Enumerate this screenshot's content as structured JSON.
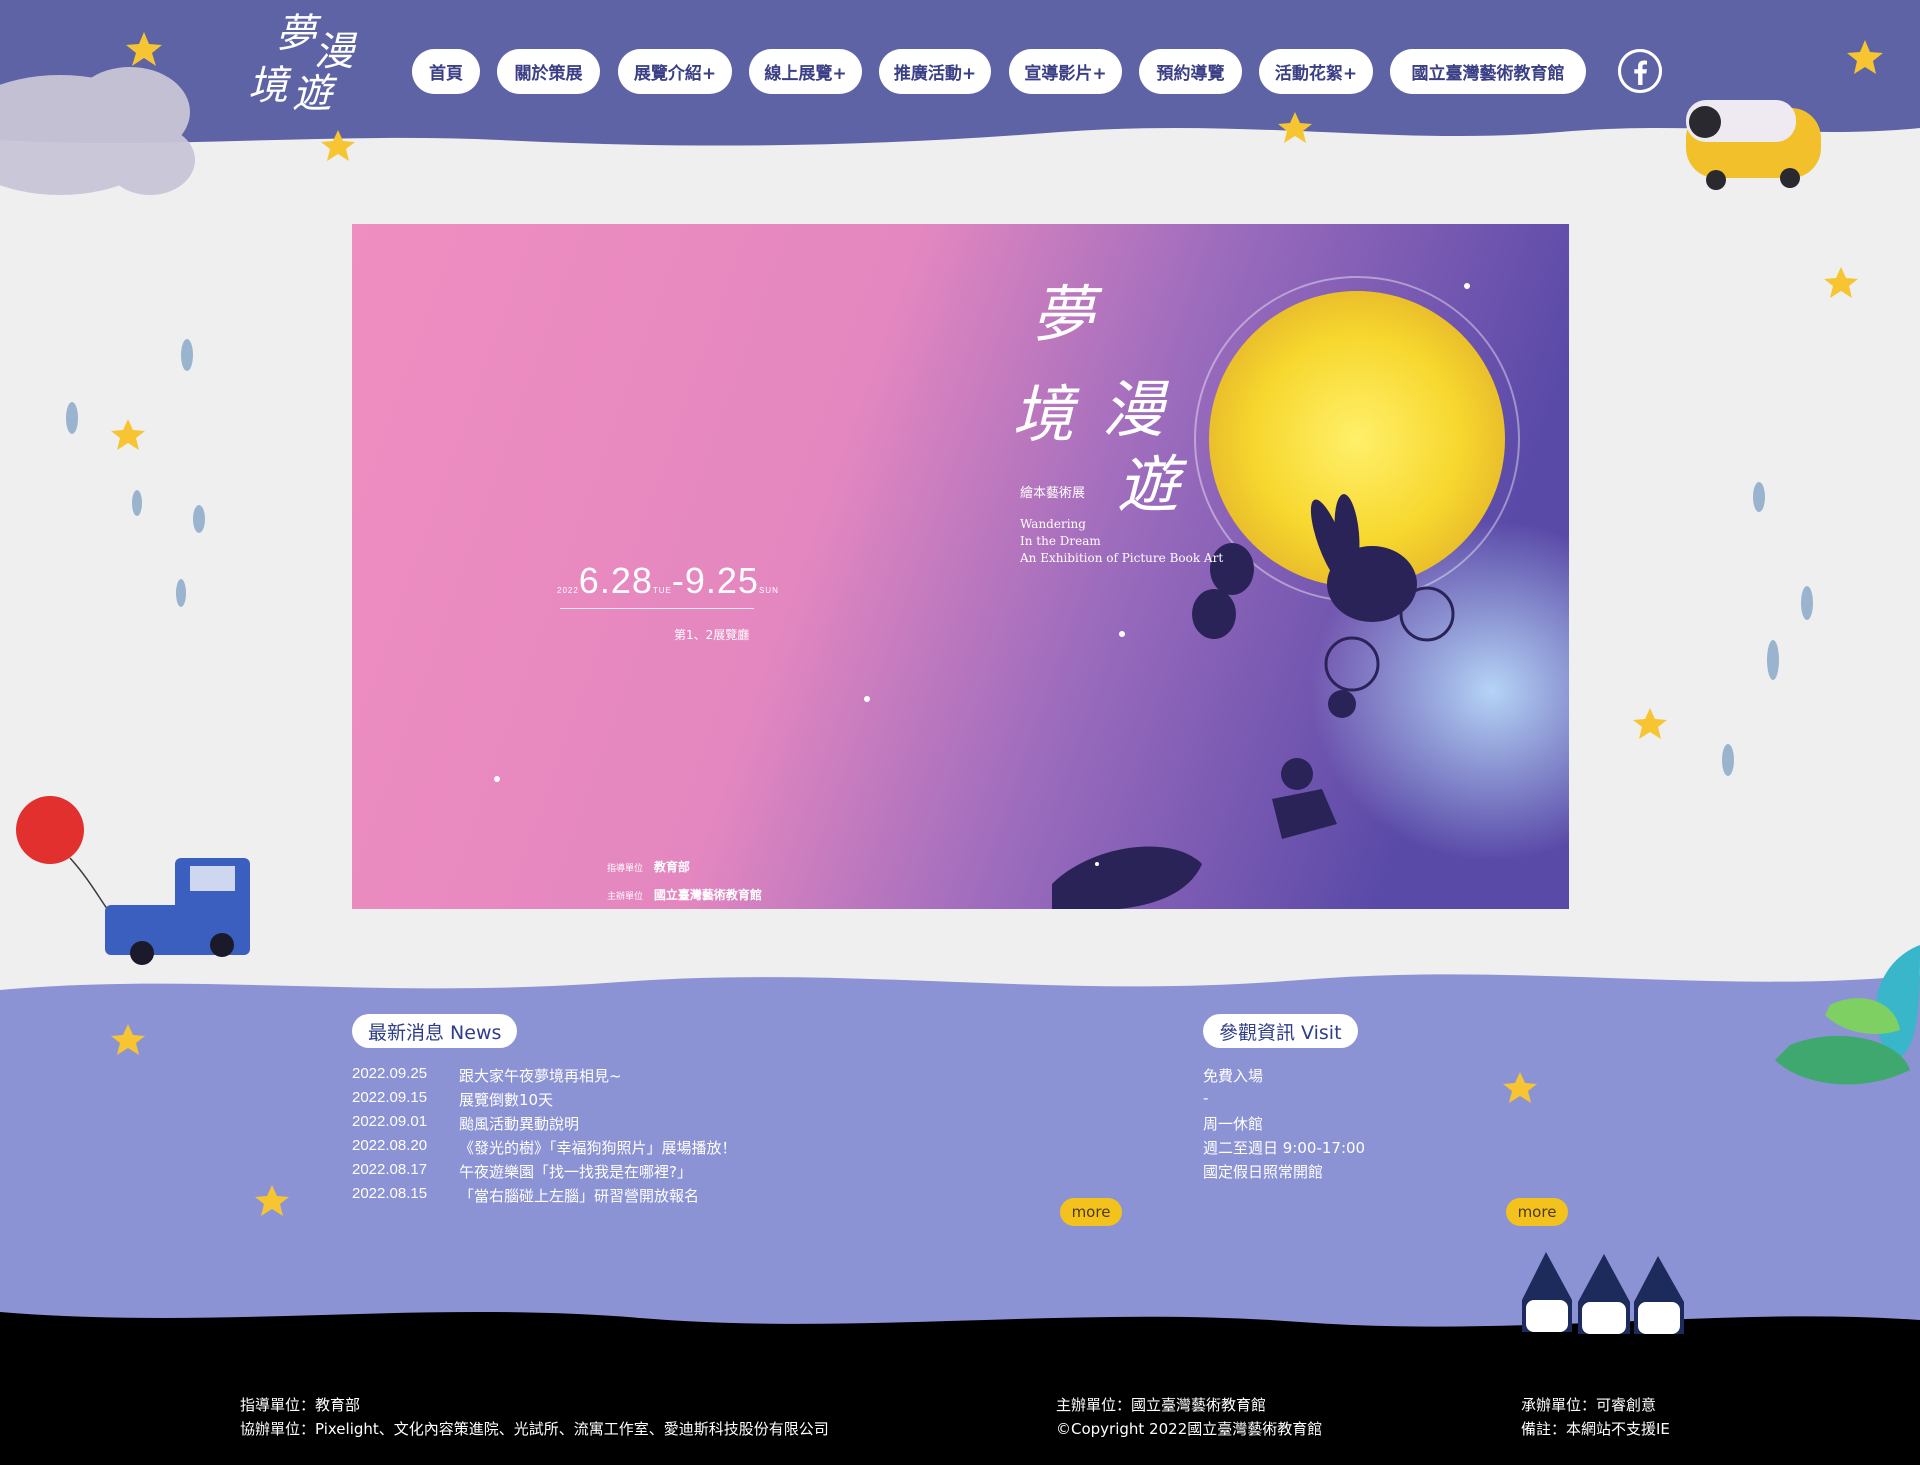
{
  "header": {
    "logo_chars": [
      "夢",
      "漫",
      "境",
      "遊"
    ],
    "nav": [
      "首頁",
      "關於策展",
      "展覽介紹+",
      "線上展覽+",
      "推廣活動+",
      "宣導影片+",
      "預約導覽",
      "活動花絮+",
      "國立臺灣藝術教育館"
    ],
    "social_icon": "facebook-icon"
  },
  "hero": {
    "title_chars": [
      "夢",
      "境",
      "漫",
      "遊"
    ],
    "subtitle": "繪本藝術展",
    "english_lines": [
      "Wandering",
      "In the Dream",
      "An Exhibition of Picture Book Art"
    ],
    "year": "2022",
    "date_start": "6.28",
    "day_start": "TUE",
    "date_end": "9.25",
    "day_end": "SUN",
    "venue": "第1、2展覽廳",
    "guide_label": "指導單位",
    "guide_org": "教育部",
    "host_label": "主辦單位",
    "host_org": "國立臺灣藝術教育館"
  },
  "news": {
    "title": "最新消息 News",
    "items": [
      {
        "date": "2022.09.25",
        "text": "跟大家午夜夢境再相見~"
      },
      {
        "date": "2022.09.15",
        "text": "展覽倒數10天"
      },
      {
        "date": "2022.09.01",
        "text": "颱風活動異動說明"
      },
      {
        "date": "2022.08.20",
        "text": "《發光的樹》「幸福狗狗照片」展場播放！"
      },
      {
        "date": "2022.08.17",
        "text": "午夜遊樂園「找一找我是在哪裡?」"
      },
      {
        "date": "2022.08.15",
        "text": "「當右腦碰上左腦」研習營開放報名"
      }
    ],
    "more": "more"
  },
  "visit": {
    "title": "參觀資訊 Visit",
    "lines": [
      "免費入場",
      "-",
      "周一休館",
      "週二至週日 9:00-17:00",
      "國定假日照常開館"
    ],
    "more": "more"
  },
  "footer": {
    "guide": "指導單位：教育部",
    "co_organizers": "協辦單位：Pixelight、文化內容策進院、光試所、流寓工作室、愛迪斯科技股份有限公司",
    "host": "主辦單位：國立臺灣藝術教育館",
    "copyright": "©Copyright 2022國立臺灣藝術教育館",
    "executor": "承辦單位：可睿創意",
    "note": "備註：本網站不支援IE"
  },
  "colors": {
    "header_bg": "#5d63a4",
    "info_bg": "#8c93d4",
    "footer_bg": "#000000",
    "page_bg": "#efeff0",
    "nav_text": "#3b3f86",
    "more_btn": "#f4c21c",
    "star": "#f6c531"
  }
}
